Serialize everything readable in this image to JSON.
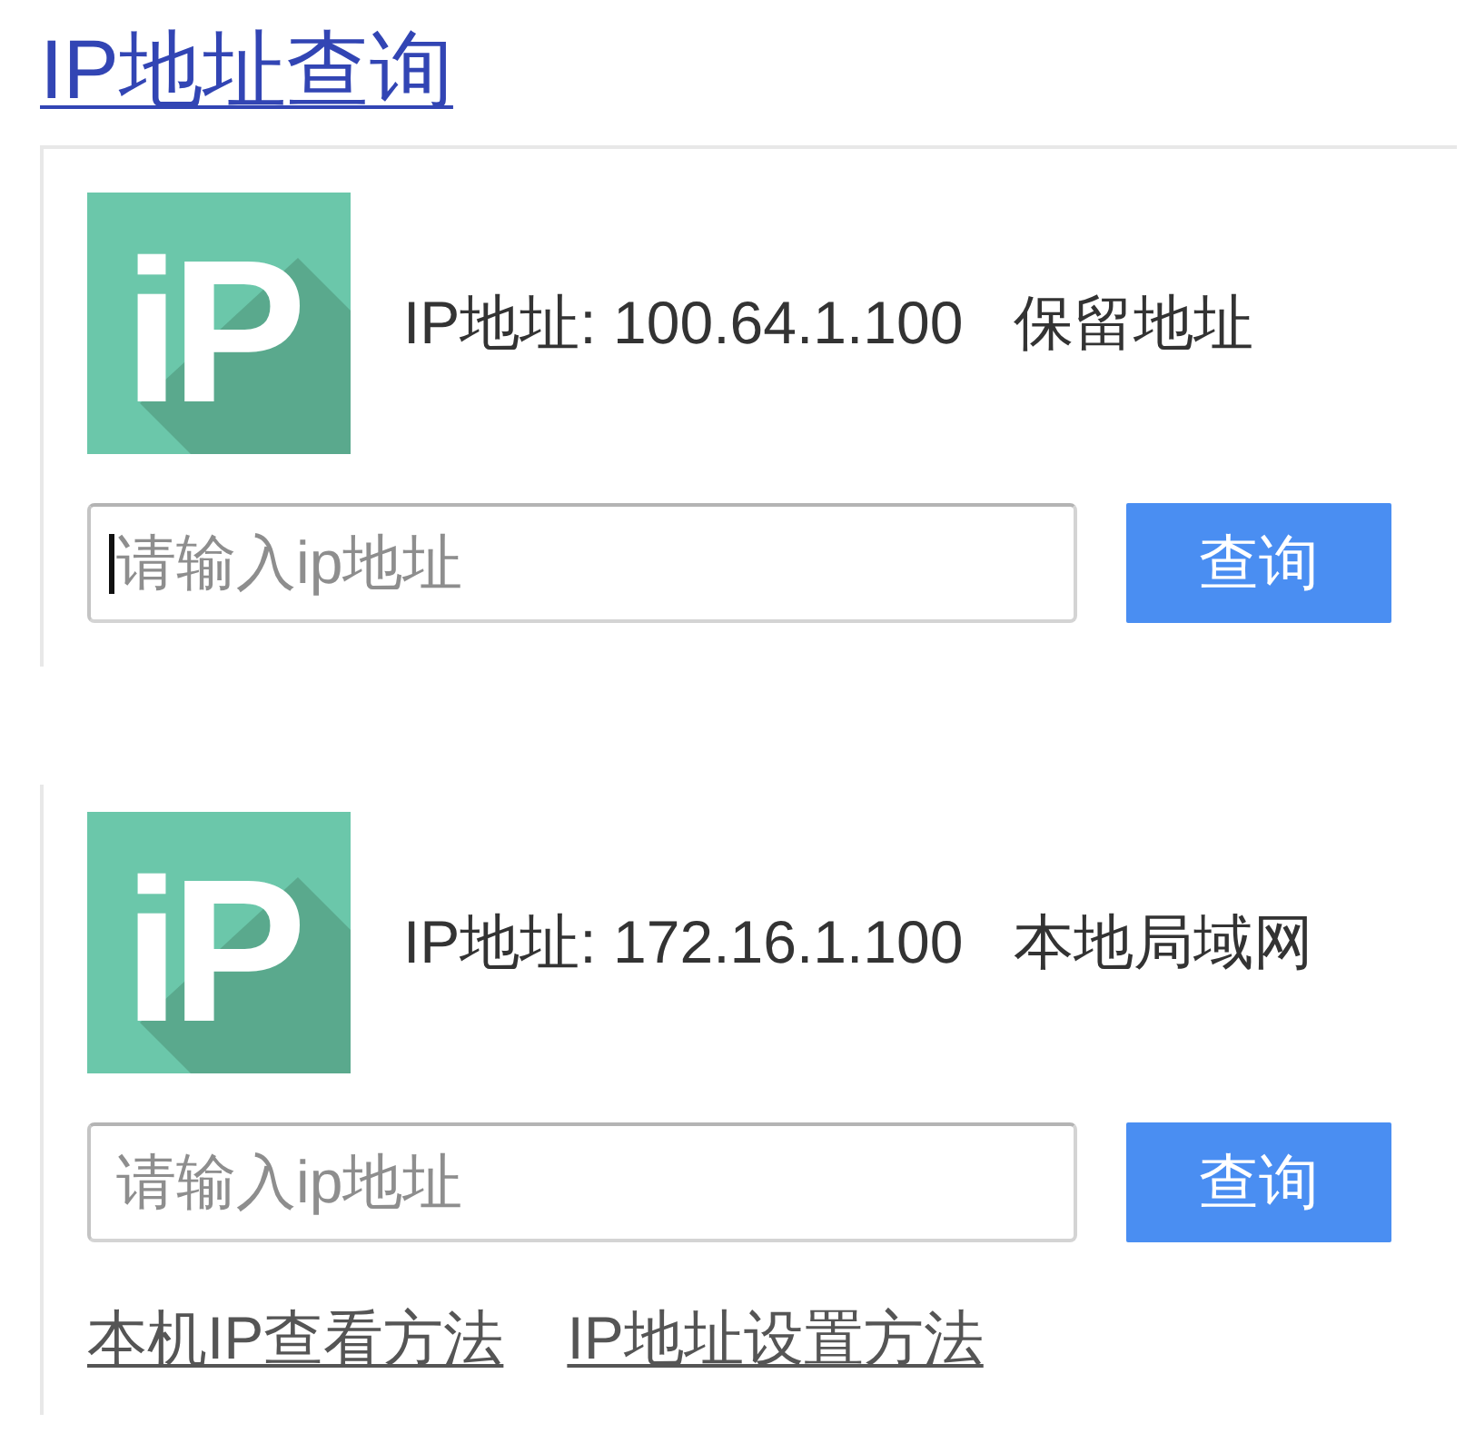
{
  "title": {
    "text": "IP地址查询"
  },
  "cards": [
    {
      "top_border": true,
      "logo": {
        "text": "iP"
      },
      "address": "IP地址: 100.64.1.100",
      "address_type": "保留地址",
      "search": {
        "placeholder": "请输入ip地址",
        "focused": true,
        "button": "查询"
      }
    },
    {
      "top_border": false,
      "logo": {
        "text": "iP"
      },
      "address": "IP地址: 172.16.1.100",
      "address_type": "本地局域网",
      "search": {
        "placeholder": "请输入ip地址",
        "focused": false,
        "button": "查询"
      },
      "links": [
        "本机IP查看方法",
        "IP地址设置方法"
      ]
    }
  ]
}
